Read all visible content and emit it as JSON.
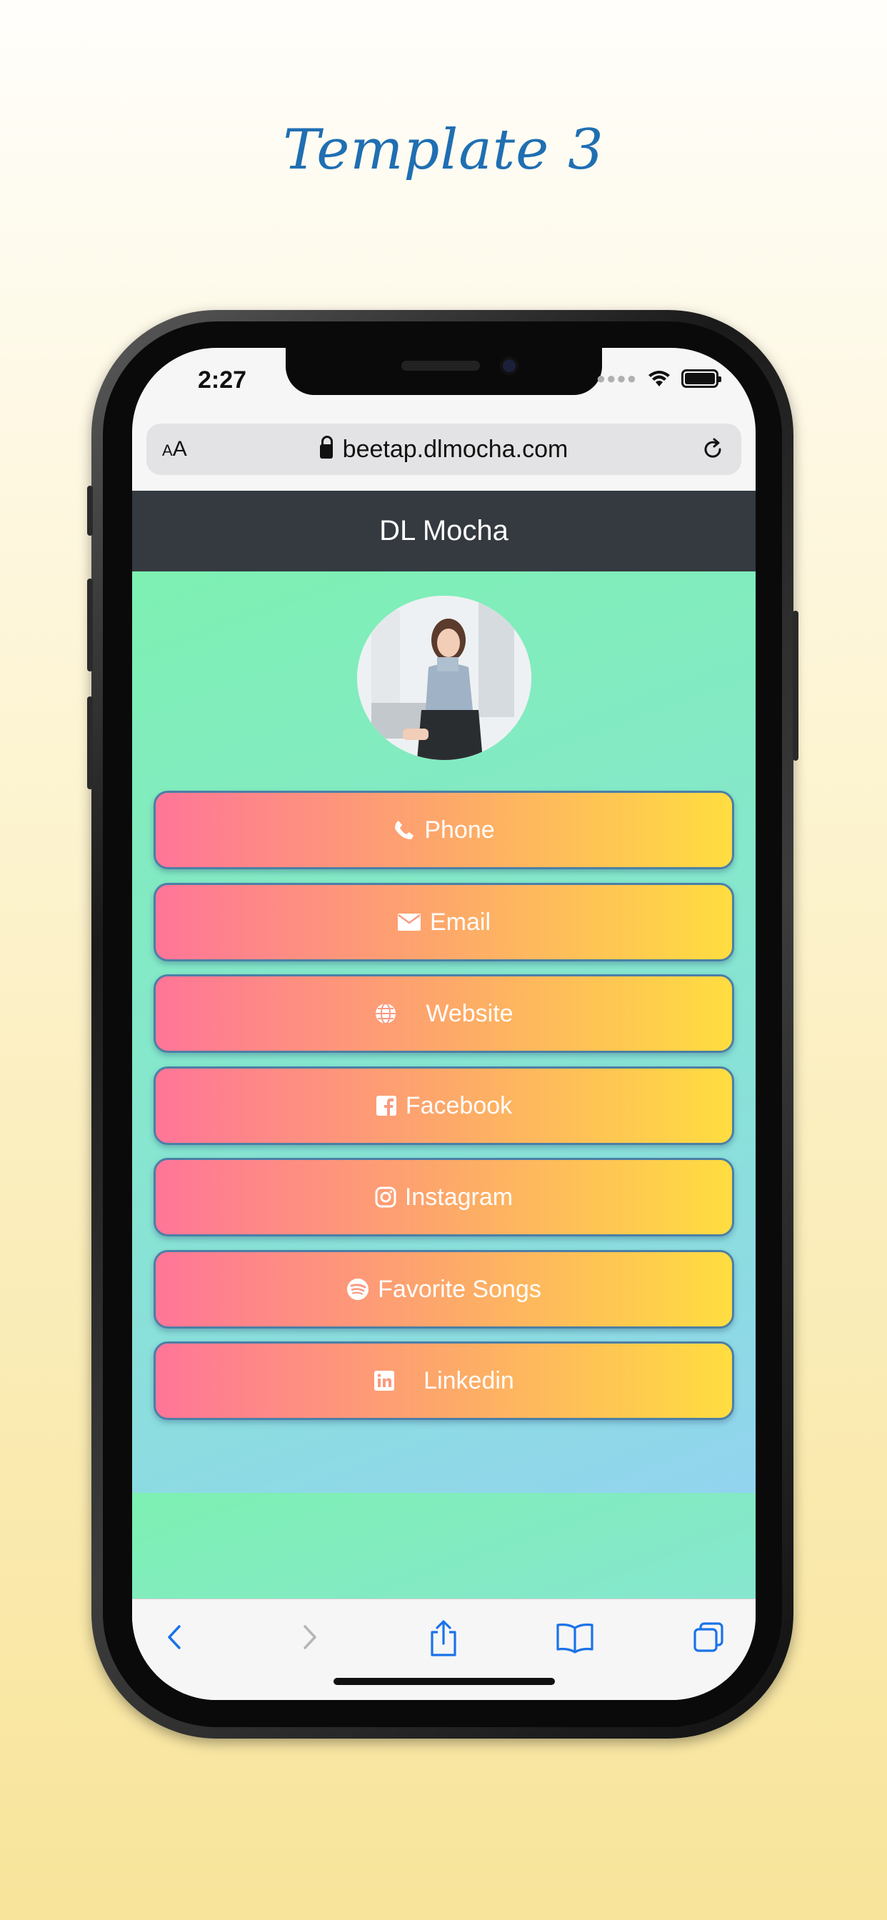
{
  "promo": {
    "title": "Template 3"
  },
  "status": {
    "time": "2:27"
  },
  "browser": {
    "text_size": "AA",
    "url": "beetap.dlmocha.com"
  },
  "site": {
    "name": "DL Mocha"
  },
  "links": [
    {
      "label": "Phone",
      "icon": "phone-icon"
    },
    {
      "label": "Email",
      "icon": "envelope-icon"
    },
    {
      "label": "Website",
      "icon": "globe-icon"
    },
    {
      "label": "Facebook",
      "icon": "facebook-icon"
    },
    {
      "label": "Instagram",
      "icon": "instagram-icon"
    },
    {
      "label": "Favorite Songs",
      "icon": "spotify-icon"
    },
    {
      "label": "Linkedin",
      "icon": "linkedin-icon"
    }
  ],
  "toolbar": {
    "items": [
      "back-icon",
      "forward-icon",
      "share-icon",
      "bookmarks-icon",
      "tabs-icon"
    ]
  },
  "colors": {
    "header": "#343a40",
    "accent": "#1f6fb2",
    "button_start": "#ff7598",
    "button_end": "#ffdd40",
    "ios_blue": "#1a73e8"
  }
}
